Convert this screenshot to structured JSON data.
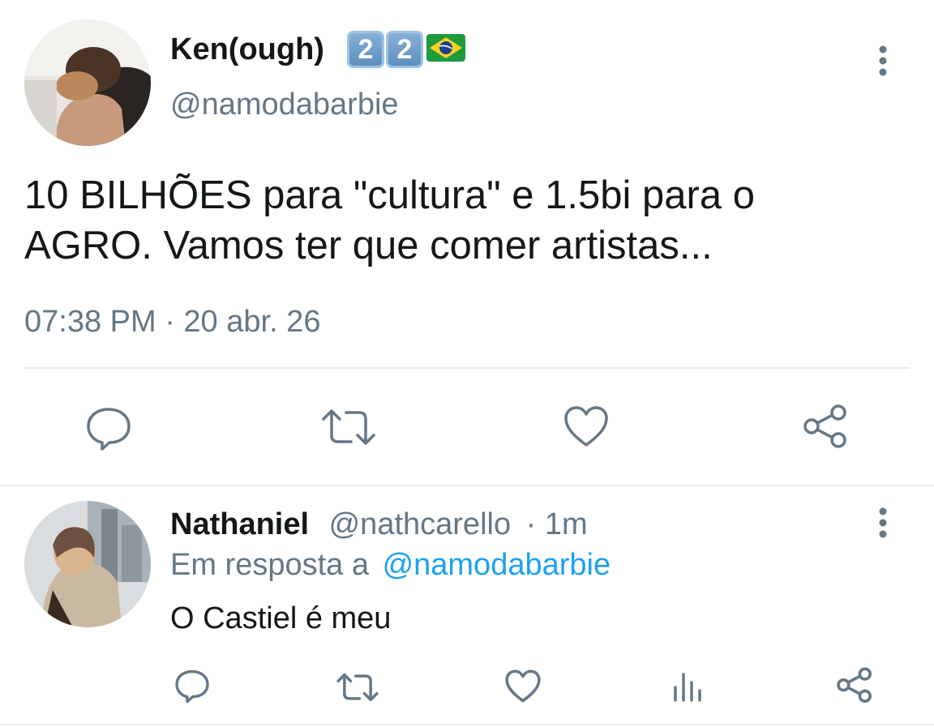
{
  "main_tweet": {
    "display_name": "Ken(ough)",
    "badges": [
      "2",
      "2"
    ],
    "flag": "🇧🇷",
    "handle": "@namodabarbie",
    "text_line1": "10 BILHÕES para \"cultura\" e 1.5bi para o",
    "text_line2": "AGRO. Vamos ter que comer artistas...",
    "timestamp": "07:38 PM · 20 abr. 26",
    "actions": [
      "reply-icon",
      "retweet-icon",
      "like-icon",
      "share-icon"
    ]
  },
  "reply": {
    "display_name": "Nathaniel",
    "handle": "@nathcarello",
    "time": "· 1m",
    "reply_prefix": "Em resposta a",
    "reply_to": "@namodabarbie",
    "text": "O Castiel é meu",
    "actions": [
      "reply-icon",
      "retweet-icon",
      "like-icon",
      "analytics-icon",
      "share-icon"
    ]
  },
  "colors": {
    "text": "#14171a",
    "muted": "#657786",
    "link": "#1da1f2",
    "divider": "#e6ecf0"
  }
}
